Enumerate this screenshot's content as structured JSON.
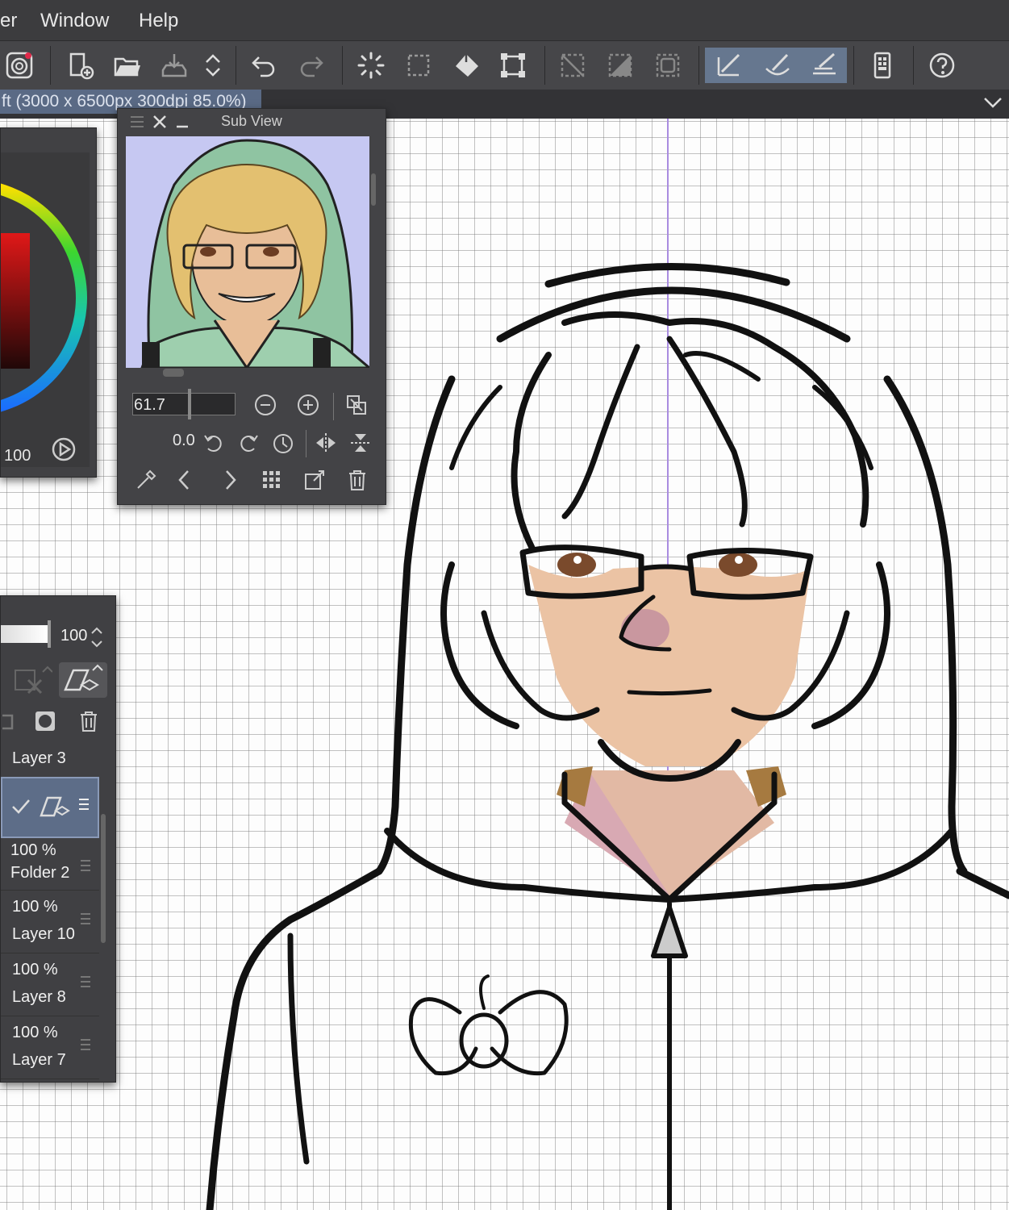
{
  "menu": {
    "partial_left": "er",
    "window": "Window",
    "help": "Help"
  },
  "toolbar": {
    "items": [
      "app-icon",
      "new-icon",
      "open-icon",
      "save-icon",
      "reorder-icon",
      "undo-icon",
      "redo-icon",
      "loading-icon",
      "select-icon",
      "fill-icon",
      "transform-icon",
      "deselect-icon",
      "invert-icon",
      "border-icon",
      "pen-icon",
      "brush-icon",
      "ruler-pen-icon",
      "phone-icon",
      "help-icon"
    ]
  },
  "tab": {
    "title": "ft (3000 x 6500px 300dpi 85.0%)"
  },
  "colors": {
    "accent": "#66778f",
    "menubar": "#3c3c3e",
    "toolbar": "#464649",
    "panel": "#414144",
    "guide": "#a98ce0"
  },
  "color_panel": {
    "opacity_value": "100"
  },
  "subview": {
    "title": "Sub View",
    "zoom_value": "61.7",
    "rotation_value": "0.0"
  },
  "layers": {
    "opacity_value": "100",
    "rows": [
      {
        "name": "Layer 3",
        "opacity": ""
      },
      {
        "name": "",
        "opacity": ""
      },
      {
        "name": "Folder 2",
        "opacity": "100 %"
      },
      {
        "name": "Layer 10",
        "opacity": "100 %"
      },
      {
        "name": "Layer 8",
        "opacity": "100 %"
      },
      {
        "name": "Layer 7",
        "opacity": "100 %"
      }
    ]
  }
}
